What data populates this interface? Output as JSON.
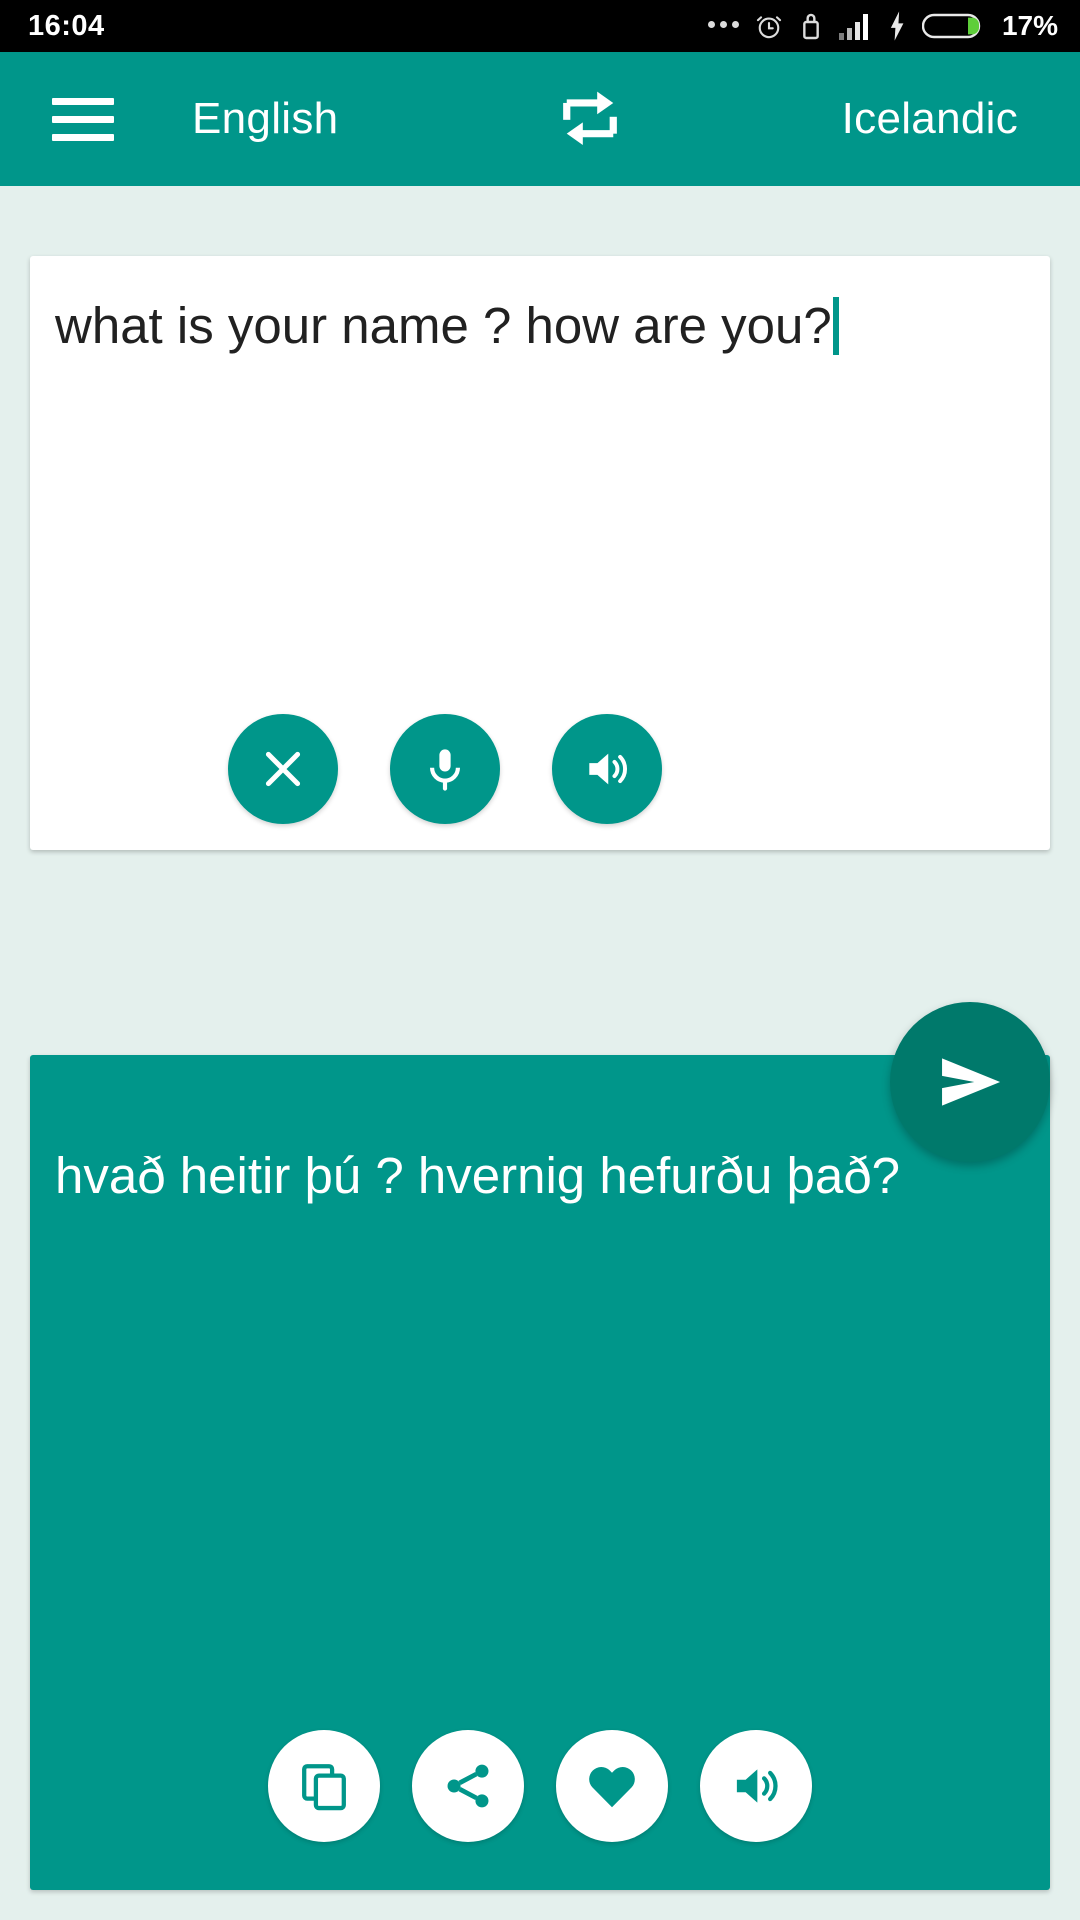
{
  "status_bar": {
    "time": "16:04",
    "battery_percent": "17%",
    "icons": [
      "more-dots-icon",
      "alarm-icon",
      "usb-icon",
      "signal-icon",
      "charging-bolt-icon",
      "battery-icon"
    ],
    "background": "#000000",
    "battery_fill_color": "#5ece3a"
  },
  "app_bar": {
    "menu_icon": "hamburger-menu-icon",
    "source_language": "English",
    "swap_icon": "swap-languages-icon",
    "target_language": "Icelandic",
    "background": "#00968a"
  },
  "source": {
    "text": "what is your name ? how are you?",
    "caret_color": "#00968a",
    "actions": [
      {
        "name": "clear",
        "icon": "close-icon"
      },
      {
        "name": "speak-input",
        "icon": "microphone-icon"
      },
      {
        "name": "listen-source",
        "icon": "volume-icon"
      }
    ]
  },
  "send_button": {
    "icon": "send-icon",
    "color": "#00796b"
  },
  "target": {
    "text": "hvað heitir þú ? hvernig hefurðu það?",
    "background": "#00968a",
    "actions": [
      {
        "name": "copy",
        "icon": "copy-icon"
      },
      {
        "name": "share",
        "icon": "share-icon"
      },
      {
        "name": "favorite",
        "icon": "heart-icon"
      },
      {
        "name": "listen-target",
        "icon": "volume-icon"
      }
    ]
  },
  "colors": {
    "accent": "#00968a",
    "accent_dark": "#00796b",
    "page_background": "#e4f0ed"
  }
}
